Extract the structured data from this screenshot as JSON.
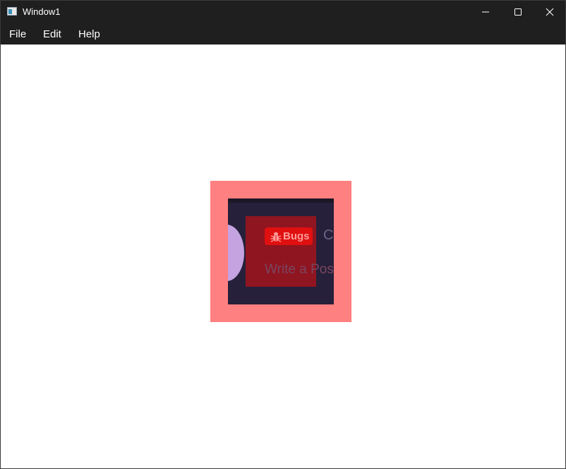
{
  "window": {
    "title": "Window1"
  },
  "menu": {
    "file": "File",
    "edit": "Edit",
    "help": "Help"
  },
  "post_card": {
    "badge_label": "Bugs",
    "cut_text": "C",
    "input_placeholder": "Write a Pos"
  },
  "icons": {
    "app": "app-window-icon",
    "minimize": "minimize-icon",
    "maximize": "maximize-icon",
    "close": "close-icon",
    "badge": "bug-icon"
  },
  "colors": {
    "titlebar_bg": "#1f1f1f",
    "debug_frame": "#ff8080",
    "viewport_bg": "#26203a",
    "overlay": "#8f1520",
    "badge_bg": "#e01010",
    "avatar": "#c4a3e0"
  }
}
